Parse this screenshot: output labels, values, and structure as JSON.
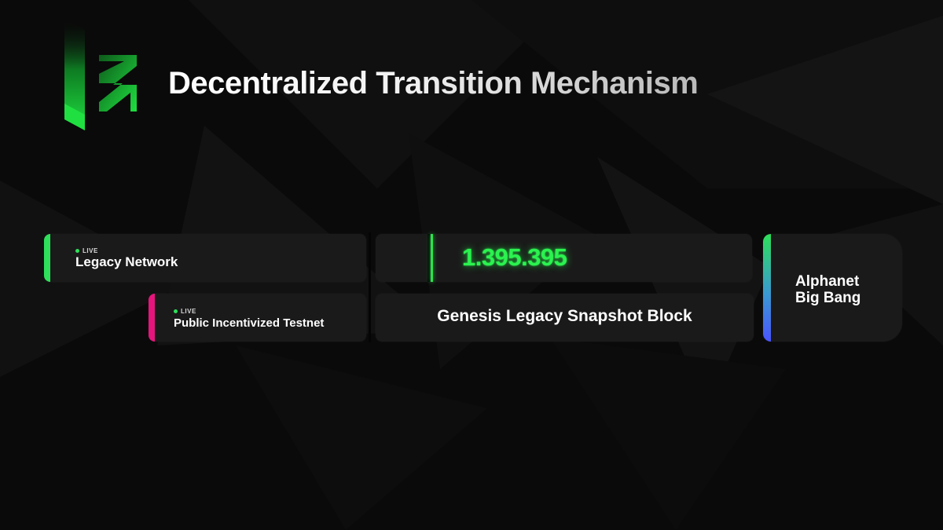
{
  "title": "Decentralized Transition Mechanism",
  "logo": {
    "icon": "zenon-logo-icon",
    "color": "#1fe040"
  },
  "networks": [
    {
      "status": "LIVE",
      "name": "Legacy Network",
      "accent": "#2ee05a"
    },
    {
      "status": "LIVE",
      "name": "Public Incentivized Testnet",
      "accent": "#e6157d"
    }
  ],
  "snapshot": {
    "block_number": "1.395.395",
    "label": "Genesis Legacy Snapshot Block"
  },
  "alphanet": {
    "line1": "Alphanet",
    "line2": "Big Bang",
    "accent_top": "#2ee05a",
    "accent_bottom": "#4a55ff"
  },
  "colors": {
    "background": "#0a0a0a",
    "card": "#1a1a1a",
    "number": "#2bf24f"
  }
}
